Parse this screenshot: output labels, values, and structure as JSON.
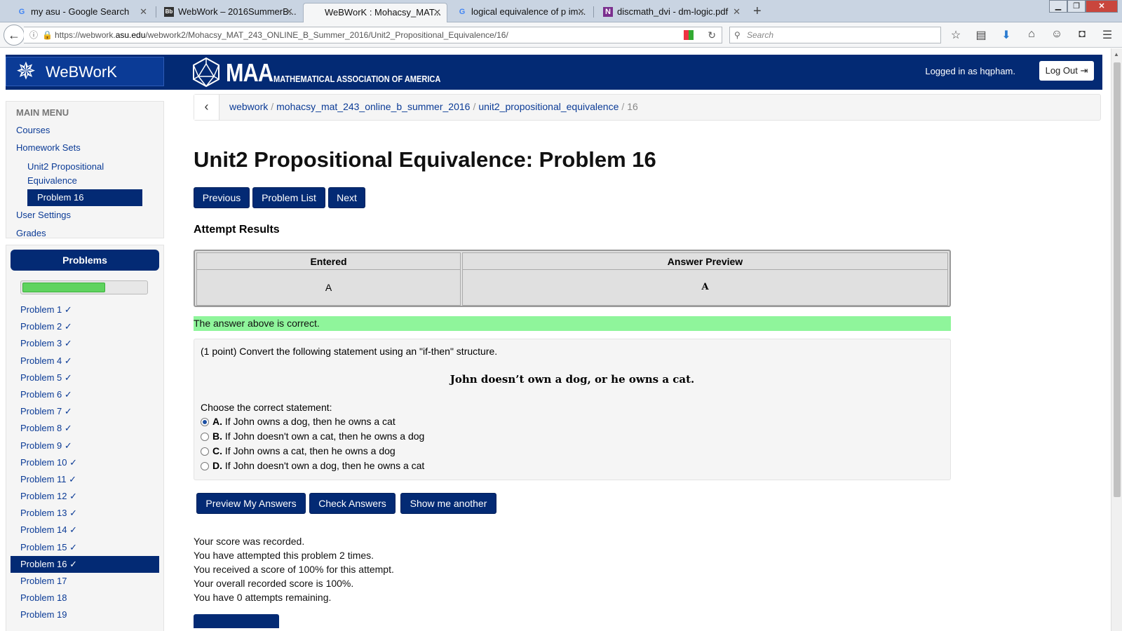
{
  "browser": {
    "tabs": [
      {
        "label": "my asu - Google Search",
        "icon": "google-icon"
      },
      {
        "label": "WebWork – 2016SummerB...",
        "icon": "blackboard-icon"
      },
      {
        "label": "WeBWorK : Mohacsy_MAT...",
        "icon": "none",
        "active": true
      },
      {
        "label": "logical equivalence of p im...",
        "icon": "google-icon"
      },
      {
        "label": "discmath_dvi - dm-logic.pdf",
        "icon": "onenote-icon"
      }
    ],
    "url_prefix": "https://webwork.",
    "url_domain": "asu.edu",
    "url_rest": "/webwork2/Mohacsy_MAT_243_ONLINE_B_Summer_2016/Unit2_Propositional_Equivalence/16/",
    "search_placeholder": "Search"
  },
  "header": {
    "logo_text": "WeBWorK",
    "maa_big": "MAA",
    "maa_small": "MATHEMATICAL ASSOCIATION OF AMERICA",
    "logged_in": "Logged in as hqpham.",
    "logout": "Log Out"
  },
  "menu": {
    "heading": "MAIN MENU",
    "courses": "Courses",
    "homework_sets": "Homework Sets",
    "set_name_line1": "Unit2 Propositional",
    "set_name_line2": "Equivalence",
    "problem": "Problem 16",
    "user_settings": "User Settings",
    "grades": "Grades"
  },
  "problems_panel": {
    "heading": "Problems",
    "progress_fraction": 0.67,
    "items": [
      "Problem 1 ✓",
      "Problem 2 ✓",
      "Problem 3 ✓",
      "Problem 4 ✓",
      "Problem 5 ✓",
      "Problem 6 ✓",
      "Problem 7 ✓",
      "Problem 8 ✓",
      "Problem 9 ✓",
      "Problem 10 ✓",
      "Problem 11 ✓",
      "Problem 12 ✓",
      "Problem 13 ✓",
      "Problem 14 ✓",
      "Problem 15 ✓",
      "Problem 16 ✓",
      "Problem 17",
      "Problem 18",
      "Problem 19"
    ],
    "current_index": 15
  },
  "breadcrumb": {
    "items": [
      "webwork",
      "mohacsy_mat_243_online_b_summer_2016",
      "unit2_propositional_equivalence"
    ],
    "current": "16"
  },
  "main": {
    "title": "Unit2 Propositional Equivalence: Problem 16",
    "nav_buttons": {
      "previous": "Previous",
      "problem_list": "Problem List",
      "next": "Next"
    },
    "attempt_heading": "Attempt Results",
    "results": {
      "col_entered": "Entered",
      "col_preview": "Answer Preview",
      "entered": "A",
      "preview": "A"
    },
    "correct_message": "The answer above is correct.",
    "question": {
      "intro": "(1 point) Convert the following statement using an \"if-then\" structure.",
      "statement": "John doesn’t own a dog, or he owns a cat.",
      "choose": "Choose the correct statement:",
      "options": [
        {
          "letter": "A.",
          "text": " If John owns a dog, then he owns a cat",
          "selected": true
        },
        {
          "letter": "B.",
          "text": " If John doesn't own a cat, then he owns a dog",
          "selected": false
        },
        {
          "letter": "C.",
          "text": " If John owns a cat, then he owns a dog",
          "selected": false
        },
        {
          "letter": "D.",
          "text": " If John doesn't own a dog, then he owns a cat",
          "selected": false
        }
      ]
    },
    "action_buttons": {
      "preview": "Preview My Answers",
      "check": "Check Answers",
      "another": "Show me another"
    },
    "score_lines": [
      "Your score was recorded.",
      "You have attempted this problem 2 times.",
      "You received a score of 100% for this attempt.",
      "Your overall recorded score is 100%.",
      "You have 0 attempts remaining."
    ]
  },
  "colors": {
    "brand_navy": "#032a74",
    "correct_green": "#8ff59b",
    "progress_green": "#5fd35f"
  }
}
